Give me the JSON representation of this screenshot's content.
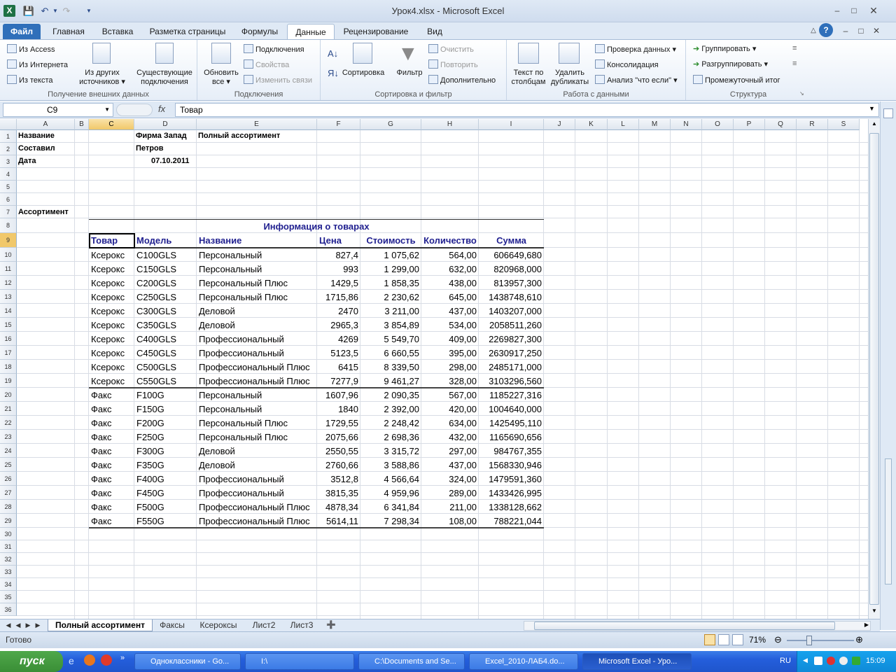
{
  "window": {
    "title": "Урок4.xlsx  -  Microsoft Excel"
  },
  "tabs": [
    "Файл",
    "Главная",
    "Вставка",
    "Разметка страницы",
    "Формулы",
    "Данные",
    "Рецензирование",
    "Вид"
  ],
  "ribbon": {
    "external": {
      "access": "Из Access",
      "web": "Из Интернета",
      "text": "Из текста",
      "other1": "Из других",
      "other2": "источников",
      "existing1": "Существующие",
      "existing2": "подключения",
      "label": "Получение внешних данных"
    },
    "connections": {
      "refresh1": "Обновить",
      "refresh2": "все",
      "conn": "Подключения",
      "props": "Свойства",
      "links": "Изменить связи",
      "label": "Подключения"
    },
    "sortfilter": {
      "sort": "Сортировка",
      "filter": "Фильтр",
      "clear": "Очистить",
      "reapply": "Повторить",
      "advanced": "Дополнительно",
      "label": "Сортировка и фильтр"
    },
    "datatools": {
      "t2c1": "Текст по",
      "t2c2": "столбцам",
      "dup1": "Удалить",
      "dup2": "дубликаты",
      "valid": "Проверка данных",
      "consol": "Консолидация",
      "whatif": "Анализ \"что если\"",
      "label": "Работа с данными"
    },
    "outline": {
      "group": "Группировать",
      "ungroup": "Разгруппировать",
      "subtotal": "Промежуточный итог",
      "label": "Структура"
    }
  },
  "formula_bar": {
    "cell_ref": "C9",
    "content": "Товар"
  },
  "columns": [
    "A",
    "B",
    "C",
    "D",
    "E",
    "F",
    "G",
    "H",
    "I",
    "J",
    "K",
    "L",
    "M",
    "N",
    "O",
    "P",
    "Q",
    "R",
    "S"
  ],
  "header_block": {
    "r1a": "Название",
    "r1d": "Фирма Запад",
    "r1e": "Полный ассортимент",
    "r2a": "Составил",
    "r2d": "Петров",
    "r3a": "Дата",
    "r3d": "07.10.2011",
    "r7a": "Ассортимент"
  },
  "table": {
    "title": "Информация о товарах",
    "headers": [
      "Товар",
      "Модель",
      "Название",
      "Цена",
      "Стоимость",
      "Количество",
      "Сумма"
    ],
    "rows": [
      [
        "Ксерокс",
        "C100GLS",
        "Персональный",
        "827,4",
        "1 075,62",
        "564,00",
        "606649,680"
      ],
      [
        "Ксерокс",
        "C150GLS",
        "Персональный",
        "993",
        "1 299,00",
        "632,00",
        "820968,000"
      ],
      [
        "Ксерокс",
        "C200GLS",
        "Персональный Плюс",
        "1429,5",
        "1 858,35",
        "438,00",
        "813957,300"
      ],
      [
        "Ксерокс",
        "C250GLS",
        "Персональный Плюс",
        "1715,86",
        "2 230,62",
        "645,00",
        "1438748,610"
      ],
      [
        "Ксерокс",
        "C300GLS",
        "Деловой",
        "2470",
        "3 211,00",
        "437,00",
        "1403207,000"
      ],
      [
        "Ксерокс",
        "C350GLS",
        "Деловой",
        "2965,3",
        "3 854,89",
        "534,00",
        "2058511,260"
      ],
      [
        "Ксерокс",
        "C400GLS",
        "Профессиональный",
        "4269",
        "5 549,70",
        "409,00",
        "2269827,300"
      ],
      [
        "Ксерокс",
        "C450GLS",
        "Профессиональный",
        "5123,5",
        "6 660,55",
        "395,00",
        "2630917,250"
      ],
      [
        "Ксерокс",
        "C500GLS",
        "Профессиональный Плюс",
        "6415",
        "8 339,50",
        "298,00",
        "2485171,000"
      ],
      [
        "Ксерокс",
        "C550GLS",
        "Профессиональный Плюс",
        "7277,9",
        "9 461,27",
        "328,00",
        "3103296,560"
      ],
      [
        "Факс",
        "F100G",
        "Персональный",
        "1607,96",
        "2 090,35",
        "567,00",
        "1185227,316"
      ],
      [
        "Факс",
        "F150G",
        "Персональный",
        "1840",
        "2 392,00",
        "420,00",
        "1004640,000"
      ],
      [
        "Факс",
        "F200G",
        "Персональный Плюс",
        "1729,55",
        "2 248,42",
        "634,00",
        "1425495,110"
      ],
      [
        "Факс",
        "F250G",
        "Персональный Плюс",
        "2075,66",
        "2 698,36",
        "432,00",
        "1165690,656"
      ],
      [
        "Факс",
        "F300G",
        "Деловой",
        "2550,55",
        "3 315,72",
        "297,00",
        "984767,355"
      ],
      [
        "Факс",
        "F350G",
        "Деловой",
        "2760,66",
        "3 588,86",
        "437,00",
        "1568330,946"
      ],
      [
        "Факс",
        "F400G",
        "Профессиональный",
        "3512,8",
        "4 566,64",
        "324,00",
        "1479591,360"
      ],
      [
        "Факс",
        "F450G",
        "Профессиональный",
        "3815,35",
        "4 959,96",
        "289,00",
        "1433426,995"
      ],
      [
        "Факс",
        "F500G",
        "Профессиональный Плюс",
        "4878,34",
        "6 341,84",
        "211,00",
        "1338128,662"
      ],
      [
        "Факс",
        "F550G",
        "Профессиональный Плюс",
        "5614,11",
        "7 298,34",
        "108,00",
        "788221,044"
      ]
    ]
  },
  "sheet_tabs": [
    "Полный ассортимент",
    "Факсы",
    "Ксероксы",
    "Лист2",
    "Лист3"
  ],
  "status": {
    "ready": "Готово",
    "zoom": "71%"
  },
  "taskbar": {
    "start": "пуск",
    "items": [
      "Одноклассники - Go...",
      "I:\\",
      "C:\\Documents and Se...",
      "Excel_2010-ЛАБ4.do...",
      "Microsoft Excel - Уро..."
    ],
    "lang": "RU",
    "clock": "15:09"
  }
}
